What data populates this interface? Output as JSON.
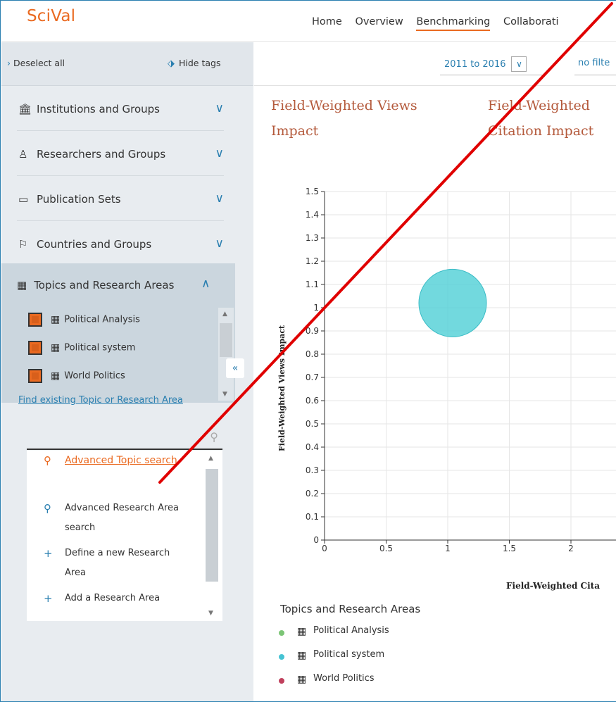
{
  "app": {
    "logo": "SciVal",
    "nav": [
      "Home",
      "Overview",
      "Benchmarking",
      "Collaborati"
    ],
    "active_nav": "Benchmarking"
  },
  "sidebar": {
    "deselect_all": "Deselect all",
    "hide_tags": "Hide tags",
    "sections": [
      {
        "label": "Institutions and Groups",
        "icon": "institution-icon"
      },
      {
        "label": "Researchers and Groups",
        "icon": "person-icon"
      },
      {
        "label": "Publication Sets",
        "icon": "document-icon"
      },
      {
        "label": "Countries and Groups",
        "icon": "flag-icon"
      }
    ],
    "topics_header": "Topics and Research Areas",
    "topics": [
      "Political Analysis",
      "Political system",
      "World Politics"
    ],
    "find_link": "Find existing Topic or Research Area",
    "menu": [
      {
        "label": "Advanced Topic search",
        "icon": "search-icon",
        "active": true
      },
      {
        "label": "Advanced Research Area search",
        "icon": "search-icon",
        "active": false
      },
      {
        "label": "Define a new Research Area",
        "icon": "plus-icon",
        "active": false
      },
      {
        "label": "Add a Research Area",
        "icon": "plus-icon",
        "active": false
      }
    ]
  },
  "toolbar": {
    "year_range": "2011 to 2016",
    "filter": "no filte"
  },
  "metrics": {
    "y_metric": "Field-Weighted Views Impact",
    "x_metric": "Field-Weighted Citation Impact"
  },
  "chart_data": {
    "type": "scatter",
    "xlabel": "Field-Weighted Cita",
    "ylabel": "Field-Weighted Views Impact",
    "xlim": [
      0,
      2.2
    ],
    "ylim": [
      0,
      1.5
    ],
    "x_ticks": [
      "0",
      "0.5",
      "1",
      "1.5",
      "2"
    ],
    "y_ticks": [
      "0",
      "0.1",
      "0.2",
      "0.3",
      "0.4",
      "0.5",
      "0.6",
      "0.7",
      "0.8",
      "0.9",
      "1",
      "1.1",
      "1.2",
      "1.3",
      "1.4",
      "1.5"
    ],
    "points": [
      {
        "series": "Political system",
        "x": 1.04,
        "y": 1.02,
        "size": "large",
        "color": "#4fcfd6"
      }
    ],
    "grid": true
  },
  "legend": {
    "title": "Topics and Research Areas",
    "items": [
      {
        "label": "Political Analysis",
        "color": "#7cc576"
      },
      {
        "label": "Political system",
        "color": "#45c3d3"
      },
      {
        "label": "World Politics",
        "color": "#c0405c"
      }
    ]
  },
  "colors": {
    "accent": "#ea6a21",
    "link": "#2a7fb0",
    "annotation": "#e00000"
  }
}
